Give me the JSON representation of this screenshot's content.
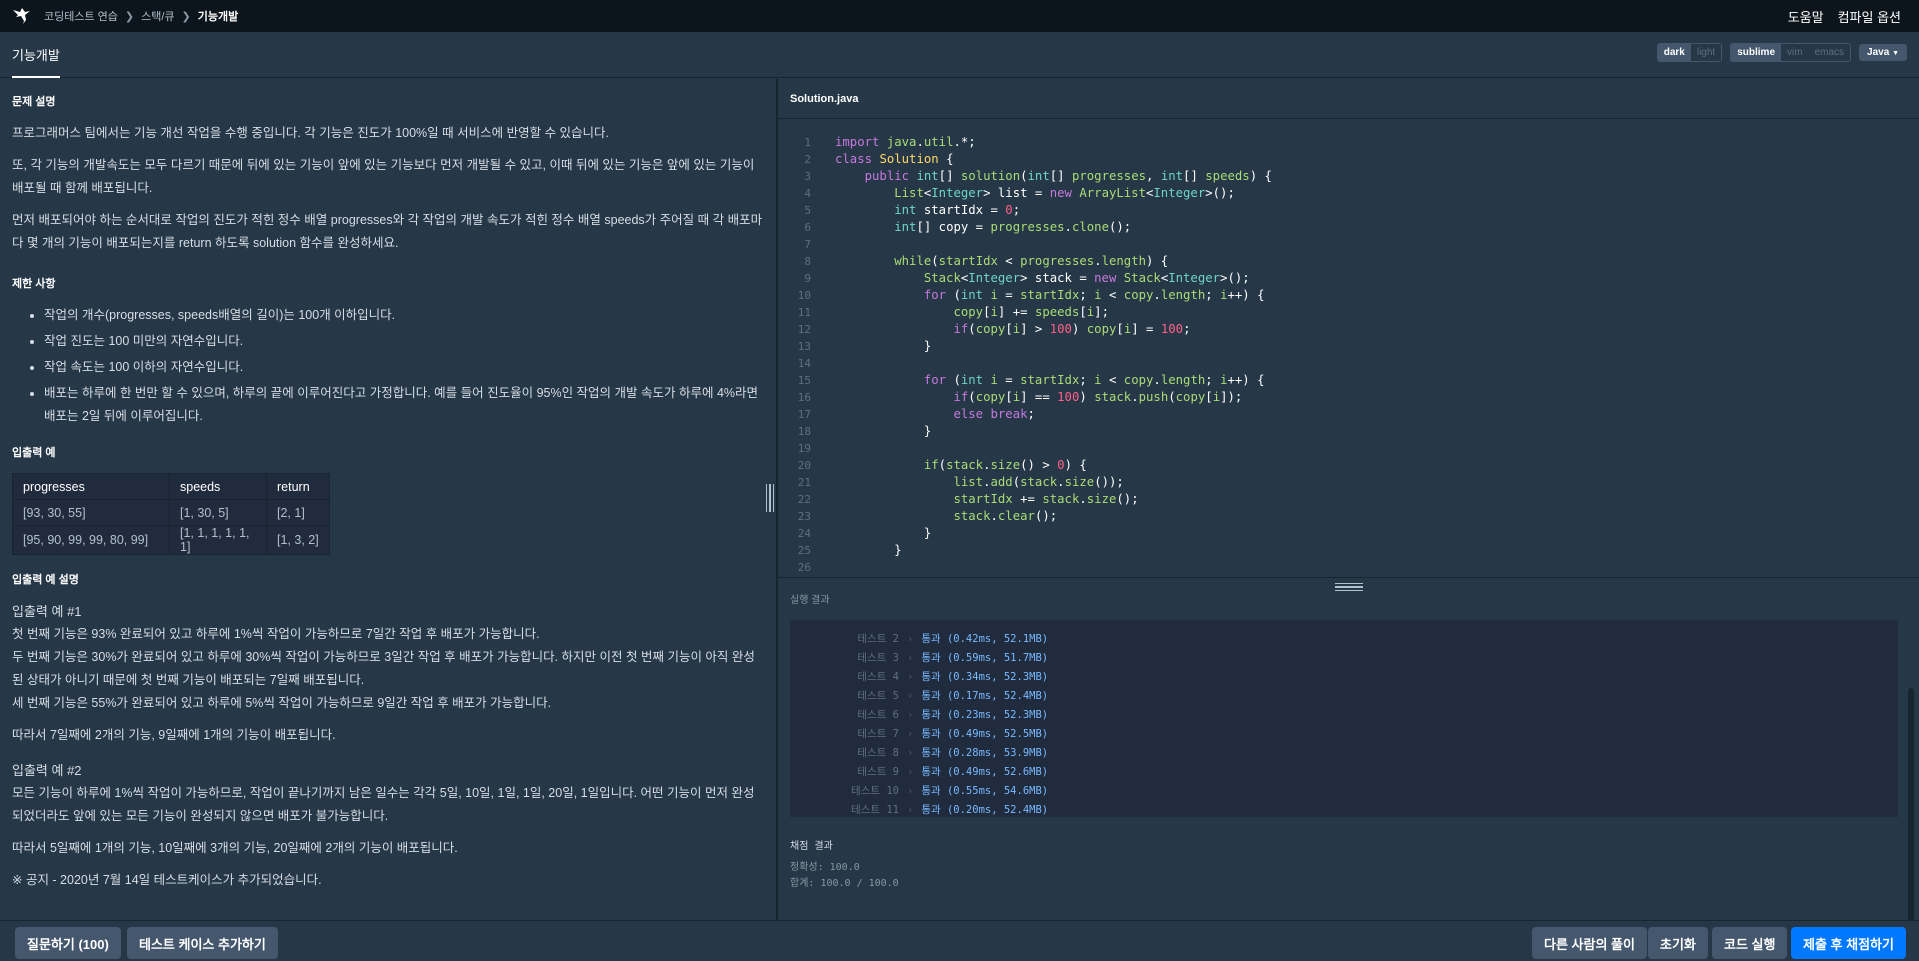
{
  "nav": {
    "breadcrumb": [
      "코딩테스트 연습",
      "스택/큐",
      "기능개발"
    ],
    "help": "도움말",
    "compile_options": "컴파일 옵션"
  },
  "title": {
    "tab": "기능개발",
    "theme_options": [
      "dark",
      "light"
    ],
    "theme_selected": "dark",
    "keymap_options": [
      "sublime",
      "vim",
      "emacs"
    ],
    "keymap_selected": "sublime",
    "language": "Java"
  },
  "problem": {
    "desc_heading": "문제 설명",
    "desc": [
      "프로그래머스 팀에서는 기능 개선 작업을 수행 중입니다. 각 기능은 진도가 100%일 때 서비스에 반영할 수 있습니다.",
      "또, 각 기능의 개발속도는 모두 다르기 때문에 뒤에 있는 기능이 앞에 있는 기능보다 먼저 개발될 수 있고, 이때 뒤에 있는 기능은 앞에 있는 기능이 배포될 때 함께 배포됩니다.",
      "먼저 배포되어야 하는 순서대로 작업의 진도가 적힌 정수 배열 progresses와 각 작업의 개발 속도가 적힌 정수 배열 speeds가 주어질 때 각 배포마다 몇 개의 기능이 배포되는지를 return 하도록 solution 함수를 완성하세요."
    ],
    "limits_heading": "제한 사항",
    "limits": [
      "작업의 개수(progresses, speeds배열의 길이)는 100개 이하입니다.",
      "작업 진도는 100 미만의 자연수입니다.",
      "작업 속도는 100 이하의 자연수입니다.",
      "배포는 하루에 한 번만 할 수 있으며, 하루의 끝에 이루어진다고 가정합니다. 예를 들어 진도율이 95%인 작업의 개발 속도가 하루에 4%라면 배포는 2일 뒤에 이루어집니다."
    ],
    "io_heading": "입출력 예",
    "io_headers": [
      "progresses",
      "speeds",
      "return"
    ],
    "io_rows": [
      [
        "[93, 30, 55]",
        "[1, 30, 5]",
        "[2, 1]"
      ],
      [
        "[95, 90, 99, 99, 80, 99]",
        "[1, 1, 1, 1, 1, 1]",
        "[1, 3, 2]"
      ]
    ],
    "explain_heading": "입출력 예 설명",
    "ex1_title": "입출력 예 #1",
    "ex1_lines": [
      "첫 번째 기능은 93% 완료되어 있고 하루에 1%씩 작업이 가능하므로 7일간 작업 후 배포가 가능합니다.",
      "두 번째 기능은 30%가 완료되어 있고 하루에 30%씩 작업이 가능하므로 3일간 작업 후 배포가 가능합니다. 하지만 이전 첫 번째 기능이 아직 완성된 상태가 아니기 때문에 첫 번째 기능이 배포되는 7일째 배포됩니다.",
      "세 번째 기능은 55%가 완료되어 있고 하루에 5%씩 작업이 가능하므로 9일간 작업 후 배포가 가능합니다."
    ],
    "ex1_summary": "따라서 7일째에 2개의 기능, 9일째에 1개의 기능이 배포됩니다.",
    "ex2_title": "입출력 예 #2",
    "ex2_lines": [
      "모든 기능이 하루에 1%씩 작업이 가능하므로, 작업이 끝나기까지 남은 일수는 각각 5일, 10일, 1일, 1일, 20일, 1일입니다. 어떤 기능이 먼저 완성되었더라도 앞에 있는 모든 기능이 완성되지 않으면 배포가 불가능합니다."
    ],
    "ex2_summary": "따라서 5일째에 1개의 기능, 10일째에 3개의 기능, 20일째에 2개의 기능이 배포됩니다.",
    "notice": "※ 공지 - 2020년 7월 14일 테스트케이스가 추가되었습니다."
  },
  "editor": {
    "filename": "Solution.java",
    "line_count": 26
  },
  "result": {
    "title": "실행 결과",
    "rows": [
      {
        "name": "테스트 2",
        "value": "통과 (0.42ms, 52.1MB)"
      },
      {
        "name": "테스트 3",
        "value": "통과 (0.59ms, 51.7MB)"
      },
      {
        "name": "테스트 4",
        "value": "통과 (0.34ms, 52.3MB)"
      },
      {
        "name": "테스트 5",
        "value": "통과 (0.17ms, 52.4MB)"
      },
      {
        "name": "테스트 6",
        "value": "통과 (0.23ms, 52.3MB)"
      },
      {
        "name": "테스트 7",
        "value": "통과 (0.49ms, 52.5MB)"
      },
      {
        "name": "테스트 8",
        "value": "통과 (0.28ms, 53.9MB)"
      },
      {
        "name": "테스트 9",
        "value": "통과 (0.49ms, 52.6MB)"
      },
      {
        "name": "테스트 10",
        "value": "통과 (0.55ms, 54.6MB)"
      },
      {
        "name": "테스트 11",
        "value": "통과 (0.20ms, 52.4MB)"
      }
    ],
    "final_title": "채점 결과",
    "accuracy": "정확성: 100.0",
    "total": "합계: 100.0 / 100.0"
  },
  "bottom": {
    "ask": "질문하기 (100)",
    "add_testcase": "테스트 케이스 추가하기",
    "others": "다른 사람의 풀이",
    "reset": "초기화",
    "run": "코드 실행",
    "submit": "제출 후 채점하기"
  },
  "colors": {
    "accent": "#0078ff",
    "background": "#263747",
    "topbar": "#0c151c"
  }
}
